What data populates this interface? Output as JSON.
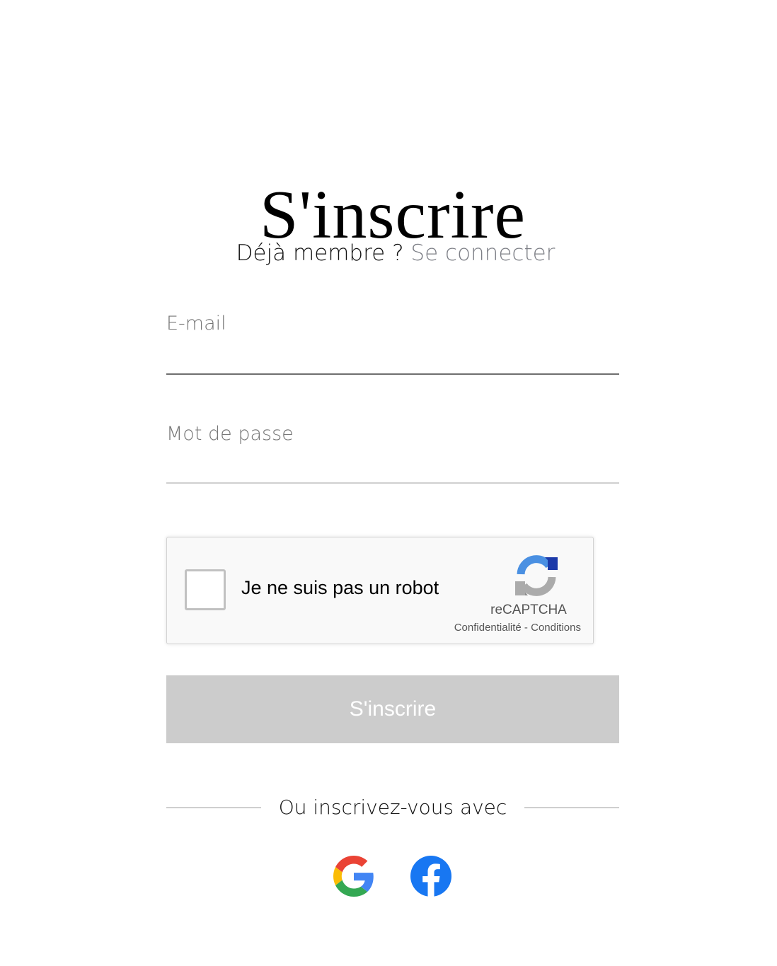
{
  "page": {
    "title": "S'inscrire"
  },
  "member_prompt": {
    "text": "Déjà membre ? ",
    "link": "Se connecter"
  },
  "form": {
    "email_label": "E-mail",
    "password_label": "Mot de passe",
    "submit_label": "S'inscrire"
  },
  "recaptcha": {
    "checkbox_label": "Je ne suis pas un robot",
    "brand": "reCAPTCHA",
    "privacy": "Confidentialité",
    "separator": " - ",
    "terms": "Conditions",
    "checked": false
  },
  "social": {
    "divider_text": "Ou inscrivez-vous avec",
    "providers": [
      {
        "name": "Google",
        "icon": "google-icon"
      },
      {
        "name": "Facebook",
        "icon": "facebook-icon"
      }
    ]
  },
  "colors": {
    "link": "#7d7f86",
    "submit_disabled": "#cccccc",
    "facebook_blue": "#1877f2"
  }
}
